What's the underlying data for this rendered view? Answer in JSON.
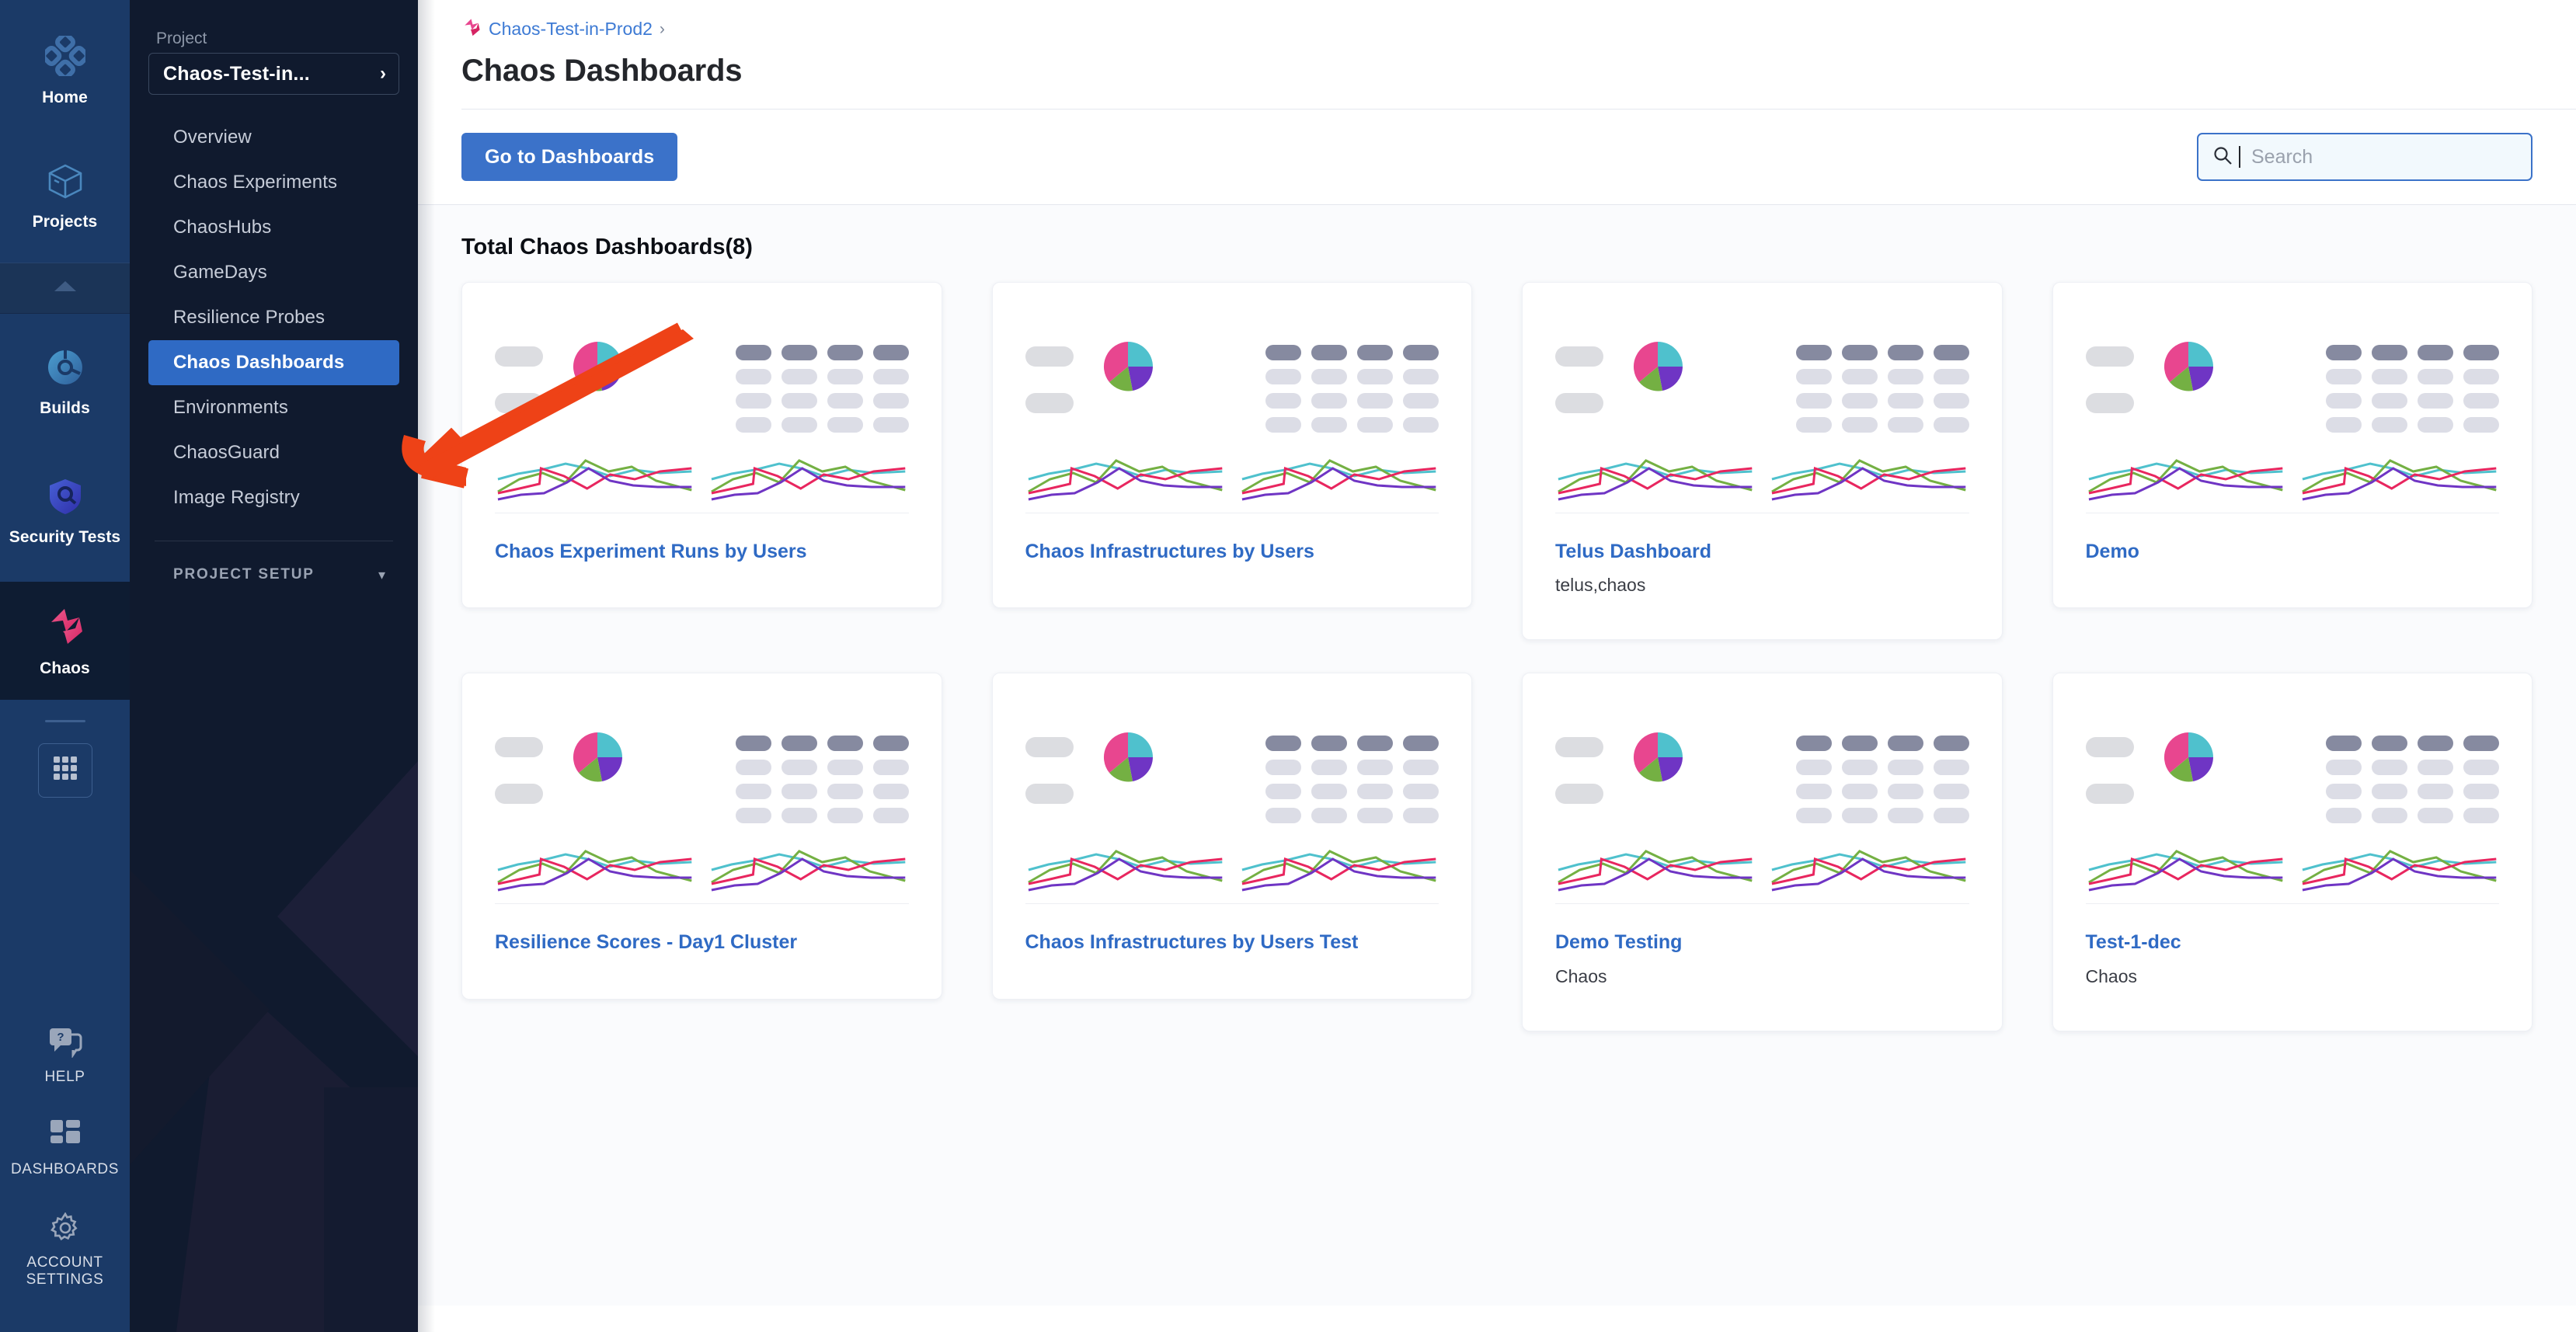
{
  "rail": {
    "top_items": [
      {
        "label": "Home",
        "icon": "home-diamond-icon"
      },
      {
        "label": "Projects",
        "icon": "cube-icon"
      }
    ],
    "collapse_icon": "collapse-chevron-up-icon",
    "module_items": [
      {
        "label": "Builds",
        "icon": "builds-icon"
      },
      {
        "label": "Security Tests",
        "icon": "shield-icon"
      }
    ],
    "active_module": {
      "label": "Chaos",
      "icon": "chaos-icon"
    },
    "apps_icon": "apps-grid-icon",
    "bottom_items": [
      {
        "label": "HELP",
        "icon": "help-chat-icon"
      },
      {
        "label": "DASHBOARDS",
        "icon": "dashboards-grid-icon"
      },
      {
        "label": "ACCOUNT SETTINGS",
        "icon": "gear-icon"
      }
    ]
  },
  "nav": {
    "project_label": "Project",
    "project_value": "Chaos-Test-in...",
    "project_chevron": "chevron-right-icon",
    "items": [
      {
        "label": "Overview",
        "active": false
      },
      {
        "label": "Chaos Experiments",
        "active": false
      },
      {
        "label": "ChaosHubs",
        "active": false
      },
      {
        "label": "GameDays",
        "active": false
      },
      {
        "label": "Resilience Probes",
        "active": false
      },
      {
        "label": "Chaos Dashboards",
        "active": true
      },
      {
        "label": "Environments",
        "active": false
      },
      {
        "label": "ChaosGuard",
        "active": false
      },
      {
        "label": "Image Registry",
        "active": false
      }
    ],
    "setup_label": "PROJECT SETUP",
    "setup_chevron": "chevron-down-icon"
  },
  "header": {
    "breadcrumb_icon": "chaos-module-icon",
    "breadcrumb": "Chaos-Test-in-Prod2",
    "breadcrumb_sep": "›",
    "title": "Chaos Dashboards"
  },
  "toolbar": {
    "go_to_dashboards_label": "Go to Dashboards",
    "search_icon": "search-icon",
    "search_placeholder": "Search",
    "search_value": ""
  },
  "content": {
    "section_title": "Total Chaos Dashboards(8)",
    "cards": [
      {
        "title": "Chaos Experiment Runs by Users",
        "subtitle": ""
      },
      {
        "title": "Chaos Infrastructures by Users",
        "subtitle": ""
      },
      {
        "title": "Telus Dashboard",
        "subtitle": "telus,chaos"
      },
      {
        "title": "Demo",
        "subtitle": ""
      },
      {
        "title": "Resilience Scores - Day1 Cluster",
        "subtitle": ""
      },
      {
        "title": "Chaos Infrastructures by Users Test",
        "subtitle": ""
      },
      {
        "title": "Demo Testing",
        "subtitle": "Chaos"
      },
      {
        "title": "Test-1-dec",
        "subtitle": "Chaos"
      }
    ]
  },
  "annotation": {
    "type": "arrow",
    "color": "#ee4217",
    "points_to": "Chaos Dashboards"
  },
  "colors": {
    "accent_blue": "#3b72c9",
    "link_blue": "#2f6ac4",
    "rail_bg": "#1b3a67",
    "nav_bg": "#101a2e",
    "active_nav": "#2f6ac4",
    "annotation_red": "#ee4217",
    "chart_pink": "#e8468f",
    "chart_teal": "#4fc1cd",
    "chart_purple": "#6f35c4",
    "chart_green": "#74b043",
    "chart_crimson": "#e8265f",
    "page_bg": "#fafbfd"
  }
}
